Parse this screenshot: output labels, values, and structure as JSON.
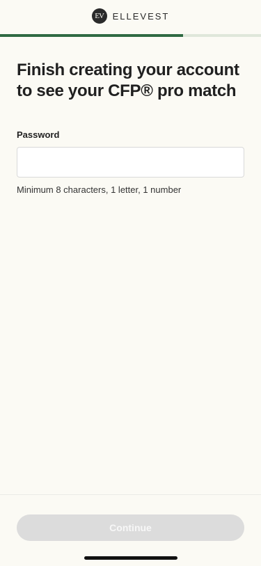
{
  "brand": {
    "mark": "EV",
    "name": "ELLEVEST"
  },
  "progress": {
    "fraction": 0.7,
    "fill_color": "#2f6a42",
    "track_color": "#dfe7da"
  },
  "main": {
    "title": "Finish creating your account to see your CFP® pro match",
    "password": {
      "label": "Password",
      "value": "",
      "placeholder": "",
      "helper": "Minimum 8 characters, 1 letter, 1 number"
    }
  },
  "footer": {
    "continue_label": "Continue",
    "continue_enabled": false
  }
}
